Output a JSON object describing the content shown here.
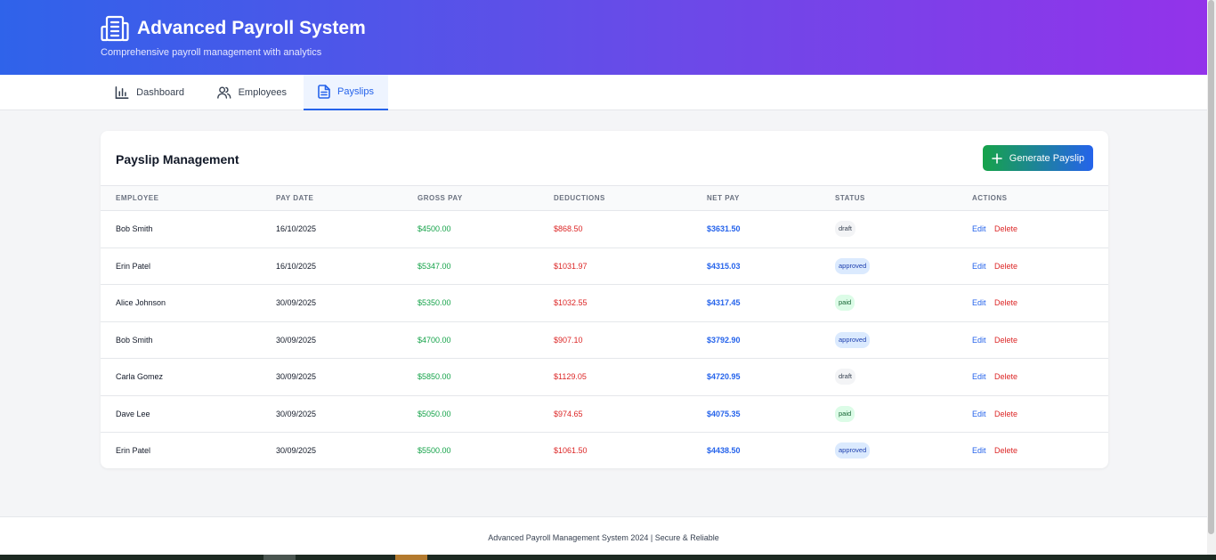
{
  "header": {
    "title": "Advanced Payroll System",
    "subtitle": "Comprehensive payroll management with analytics",
    "icon": "building-icon"
  },
  "nav": {
    "tabs": [
      {
        "label": "Dashboard",
        "icon": "bar-chart-icon",
        "active": false
      },
      {
        "label": "Employees",
        "icon": "users-icon",
        "active": false
      },
      {
        "label": "Payslips",
        "icon": "document-icon",
        "active": true
      }
    ]
  },
  "main": {
    "card_title": "Payslip Management",
    "generate_button": "Generate Payslip",
    "columns": [
      "EMPLOYEE",
      "PAY DATE",
      "GROSS PAY",
      "DEDUCTIONS",
      "NET PAY",
      "STATUS",
      "ACTIONS"
    ],
    "rows": [
      {
        "employee": "Bob Smith",
        "pay_date": "16/10/2025",
        "gross": "$4500.00",
        "deductions": "$868.50",
        "net": "$3631.50",
        "status": "draft",
        "edit": "Edit",
        "delete": "Delete"
      },
      {
        "employee": "Erin Patel",
        "pay_date": "16/10/2025",
        "gross": "$5347.00",
        "deductions": "$1031.97",
        "net": "$4315.03",
        "status": "approved",
        "edit": "Edit",
        "delete": "Delete"
      },
      {
        "employee": "Alice Johnson",
        "pay_date": "30/09/2025",
        "gross": "$5350.00",
        "deductions": "$1032.55",
        "net": "$4317.45",
        "status": "paid",
        "edit": "Edit",
        "delete": "Delete"
      },
      {
        "employee": "Bob Smith",
        "pay_date": "30/09/2025",
        "gross": "$4700.00",
        "deductions": "$907.10",
        "net": "$3792.90",
        "status": "approved",
        "edit": "Edit",
        "delete": "Delete"
      },
      {
        "employee": "Carla Gomez",
        "pay_date": "30/09/2025",
        "gross": "$5850.00",
        "deductions": "$1129.05",
        "net": "$4720.95",
        "status": "draft",
        "edit": "Edit",
        "delete": "Delete"
      },
      {
        "employee": "Dave Lee",
        "pay_date": "30/09/2025",
        "gross": "$5050.00",
        "deductions": "$974.65",
        "net": "$4075.35",
        "status": "paid",
        "edit": "Edit",
        "delete": "Delete"
      },
      {
        "employee": "Erin Patel",
        "pay_date": "30/09/2025",
        "gross": "$5500.00",
        "deductions": "$1061.50",
        "net": "$4438.50",
        "status": "approved",
        "edit": "Edit",
        "delete": "Delete"
      }
    ]
  },
  "footer": {
    "text": "Advanced Payroll Management System 2024 | Secure & Reliable"
  },
  "colors": {
    "header_gradient_start": "#2f63ea",
    "header_gradient_end": "#9333ea",
    "accent": "#2563eb",
    "gross": "#16a34a",
    "deductions": "#dc2626"
  }
}
